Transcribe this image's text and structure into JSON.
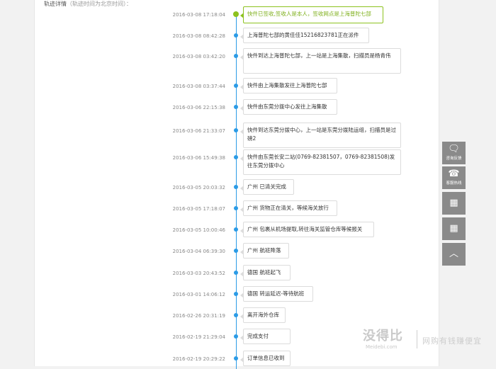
{
  "header": {
    "title": "轨迹详情",
    "note": "（轨迹时间为北京时间）："
  },
  "events": [
    {
      "time": "2016-03-08 17:18:04",
      "text": "快件已签收,签收人是本人，签收网点是上海普陀七部",
      "status": "delivered"
    },
    {
      "time": "2016-03-08 08:42:28",
      "text": "上海普陀七部的黄佳佳15216823781正在派件"
    },
    {
      "time": "2016-03-08 03:42:20",
      "text": "快件到达上海普陀七部，上一站是上海集散，扫描员是杨青伟"
    },
    {
      "time": "2016-03-08 03:37:44",
      "text": "快件由上海集散发往上海普陀七部"
    },
    {
      "time": "2016-03-06 22:15:38",
      "text": "快件由东莞分拨中心发往上海集散"
    },
    {
      "time": "2016-03-06 21:33:07",
      "text": "快件到达东莞分拨中心，上一站是东莞分拨陆运组，扫描员是过磅2"
    },
    {
      "time": "2016-03-06 15:49:38",
      "text": "快件由东莞长安二站(0769-82381507，0769-82381508)发往东莞分拨中心"
    },
    {
      "time": "2016-03-05 20:03:32",
      "text": "广州 已清关完成"
    },
    {
      "time": "2016-03-05 17:18:07",
      "text": "广州 货物正在清关，等候海关放行"
    },
    {
      "time": "2016-03-05 10:00:46",
      "text": "广州 包裹从机场提取,转往海关监管仓库等候报关"
    },
    {
      "time": "2016-03-04 06:39:30",
      "text": "广州 航班降落"
    },
    {
      "time": "2016-03-03 20:43:52",
      "text": "德国 航班起飞"
    },
    {
      "time": "2016-03-01 14:06:12",
      "text": "德国 转运延迟-等待航班"
    },
    {
      "time": "2016-02-26 20:31:19",
      "text": "离开海外仓库"
    },
    {
      "time": "2016-02-19 21:29:04",
      "text": "完成支付"
    },
    {
      "time": "2016-02-19 20:29:22",
      "text": "订单信息已收到"
    }
  ],
  "sidebar": {
    "feedback": {
      "icon": "chat-bubble-icon",
      "label": "咨询反馈"
    },
    "hotline": {
      "icon": "headset-icon",
      "label": "客服热线"
    },
    "qrcode": {
      "icon": "qr-code-icon"
    },
    "app": {
      "icon": "grid-app-icon"
    },
    "top": {
      "icon": "chevron-up-icon"
    }
  },
  "watermark": {
    "logo": "没得比",
    "domain": "Meidebi.com",
    "slogan": "网购有钱赚便宜"
  },
  "colors": {
    "accent_blue": "#2b9be6",
    "delivered_green": "#8dc21f",
    "sidebar_gray": "#8a8a8a"
  }
}
